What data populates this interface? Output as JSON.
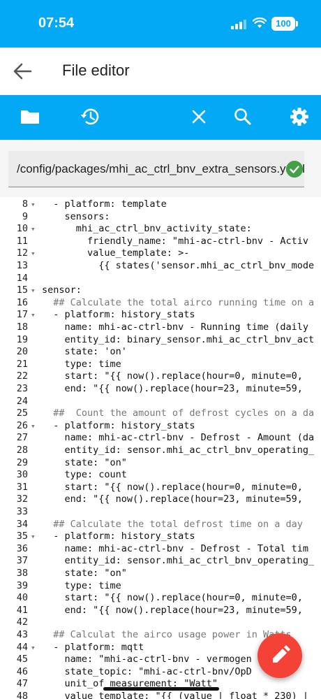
{
  "status_bar": {
    "time": "07:54",
    "battery": "100"
  },
  "appbar": {
    "title": "File editor"
  },
  "toolbar": {
    "icons": [
      "folder-icon",
      "history-icon",
      "close-icon",
      "search-icon",
      "gear-icon"
    ]
  },
  "path": {
    "value": "/config/packages/mhi_ac_ctrl_bnv_extra_sensors.yaml"
  },
  "editor": {
    "lines": [
      {
        "n": "8",
        "fold": "▾",
        "text": "  - platform: template"
      },
      {
        "n": "9",
        "fold": "",
        "text": "    sensors:"
      },
      {
        "n": "10",
        "fold": "▾",
        "text": "      mhi_ac_ctrl_bnv_activity_state:"
      },
      {
        "n": "11",
        "fold": "",
        "text": "        friendly_name: \"mhi-ac-ctrl-bnv - Activ"
      },
      {
        "n": "12",
        "fold": "▾",
        "text": "        value_template: >-"
      },
      {
        "n": "13",
        "fold": "",
        "text": "          {{ states('sensor.mhi_ac_ctrl_bnv_mode"
      },
      {
        "n": "14",
        "fold": "",
        "text": ""
      },
      {
        "n": "15",
        "fold": "▾",
        "text": "sensor:"
      },
      {
        "n": "16",
        "fold": "",
        "text": "  ## Calculate the total airco running time on a"
      },
      {
        "n": "17",
        "fold": "▾",
        "text": "  - platform: history_stats"
      },
      {
        "n": "18",
        "fold": "",
        "text": "    name: mhi-ac-ctrl-bnv - Running time (daily"
      },
      {
        "n": "19",
        "fold": "",
        "text": "    entity_id: binary_sensor.mhi_ac_ctrl_bnv_act"
      },
      {
        "n": "20",
        "fold": "",
        "text": "    state: 'on'"
      },
      {
        "n": "21",
        "fold": "",
        "text": "    type: time"
      },
      {
        "n": "22",
        "fold": "",
        "text": "    start: \"{{ now().replace(hour=0, minute=0,"
      },
      {
        "n": "23",
        "fold": "",
        "text": "    end: \"{{ now().replace(hour=23, minute=59,"
      },
      {
        "n": "24",
        "fold": "",
        "text": ""
      },
      {
        "n": "25",
        "fold": "",
        "text": "  ##  Count the amount of defrost cycles on a da"
      },
      {
        "n": "26",
        "fold": "▾",
        "text": "  - platform: history_stats"
      },
      {
        "n": "27",
        "fold": "",
        "text": "    name: mhi-ac-ctrl-bnv - Defrost - Amount (da"
      },
      {
        "n": "28",
        "fold": "",
        "text": "    entity_id: sensor.mhi_ac_ctrl_bnv_operating_"
      },
      {
        "n": "29",
        "fold": "",
        "text": "    state: \"on\""
      },
      {
        "n": "30",
        "fold": "",
        "text": "    type: count"
      },
      {
        "n": "31",
        "fold": "",
        "text": "    start: \"{{ now().replace(hour=0, minute=0,"
      },
      {
        "n": "32",
        "fold": "",
        "text": "    end: \"{{ now().replace(hour=23, minute=59,"
      },
      {
        "n": "33",
        "fold": "",
        "text": ""
      },
      {
        "n": "34",
        "fold": "",
        "text": "  ## Calculate the total defrost time on a day"
      },
      {
        "n": "35",
        "fold": "▾",
        "text": "  - platform: history_stats"
      },
      {
        "n": "36",
        "fold": "",
        "text": "    name: mhi-ac-ctrl-bnv - Defrost - Total tim"
      },
      {
        "n": "37",
        "fold": "",
        "text": "    entity_id: sensor.mhi_ac_ctrl_bnv_operating_"
      },
      {
        "n": "38",
        "fold": "",
        "text": "    state: \"on\""
      },
      {
        "n": "39",
        "fold": "",
        "text": "    type: time"
      },
      {
        "n": "40",
        "fold": "",
        "text": "    start: \"{{ now().replace(hour=0, minute=0,"
      },
      {
        "n": "41",
        "fold": "",
        "text": "    end: \"{{ now().replace(hour=23, minute=59,"
      },
      {
        "n": "42",
        "fold": "",
        "text": ""
      },
      {
        "n": "43",
        "fold": "",
        "text": "  ## Calculat the airco usage power in Watts"
      },
      {
        "n": "44",
        "fold": "▾",
        "text": "  - platform: mqtt"
      },
      {
        "n": "45",
        "fold": "",
        "text": "    name: \"mhi-ac-ctrl-bnv - vermogen"
      },
      {
        "n": "46",
        "fold": "",
        "text": "    state_topic: \"mhi-ac-ctrl-bnv/OpD"
      },
      {
        "n": "47",
        "fold": "",
        "text": "    unit_of_measurement: \"Watt\""
      },
      {
        "n": "48",
        "fold": "",
        "text": "    value_template: \"{{ (value | float * 230) |"
      }
    ]
  },
  "colors": {
    "primary": "#03a9f4",
    "fab": "#f44336",
    "ok": "#43a047",
    "dash": "#a0105f"
  }
}
